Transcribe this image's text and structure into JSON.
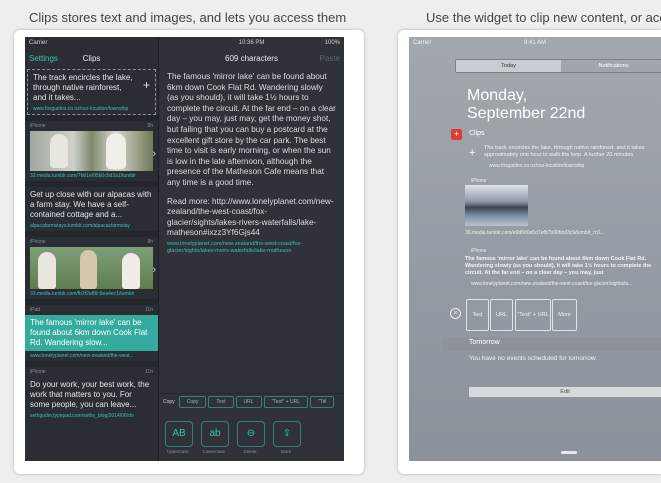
{
  "captions": {
    "left": "Clips stores text and images, and lets you access them easily later.",
    "right": "Use the widget to clip new content, or access your s"
  },
  "colors": {
    "accent": "#39c0b3",
    "dark": "#2a2e34",
    "selected_row": "#35ab9f"
  },
  "left_device": {
    "status": {
      "carrier": "Carrier",
      "time": "10:36 PM",
      "battery": "100%"
    },
    "nav": {
      "settings": "Settings",
      "title": "Clips",
      "detail_title": "609 characters",
      "paste": "Paste"
    },
    "clips": [
      {
        "text": "The track encircles the lake, through native rainforest, and it takes...",
        "url": "www.foxguides.co.nz/our-location/township",
        "add": "+"
      },
      {
        "source": "iPhone",
        "time": "5h",
        "url": "33.media.tumblr.com/7bb1e6f5b0c6d3a1/tumblr",
        "chevron": "›"
      },
      {
        "text": "Get up close with our alpacas with a farm stay. We have a self-contained cottage and a...",
        "url": "alpacafarmstays.tumblr.com/alpacasfarmstay"
      },
      {
        "source": "iPhone",
        "time": "8h",
        "url": "33.media.tumblr.com/fb2f2a88c8ea4ec1/tumblr",
        "chevron": "›"
      },
      {
        "source": "iPad",
        "time": "11h",
        "text": "The famous 'mirror lake' can be found about 6km down Cook Flat Rd. Wandering slow...",
        "url": "www.lonelyplanet.com/new-zealand/the-west..."
      },
      {
        "source": "iPhone",
        "time": "11h",
        "text": "Do your work, your best work, the work that matters to you. For some people, you can leave...",
        "url": "sethgodin.typepad.com/seths_blog/2014/06/do"
      }
    ],
    "detail": {
      "body1": "The famous 'mirror lake' can be found about 6km down Cook Flat Rd. Wandering slowly (as you should), it will take 1½ hours to complete the circuit. At the far end – on a clear day – you may, just may, get the money shot, but failing that you can buy a postcard at the excellent gift store by the car park. The best time to visit is early morning, or when the sun is low in the late afternoon, although the presence of the Matheson Cafe means that any time is a good time.",
      "body2": "Read more: http://www.lonelyplanet.com/new-zealand/the-west-coast/fox-glacier/sights/lakes-rivers-waterfalls/lake-matheson#ixzz3Yf6Gjs44",
      "source": "www.lonelyplanet.com/new-zealand/the-west-coast/fox-glacier/sights/lakes-rivers-waterfalls/lake-matheson"
    },
    "actions": {
      "copy_label": "Copy",
      "copy": "Copy",
      "text": "Text",
      "url": "URL",
      "text_url": "\"Text\" + URL",
      "more": "\"Titl"
    },
    "big_buttons": [
      {
        "glyph": "AB",
        "label": "Uppercase"
      },
      {
        "glyph": "ab",
        "label": "Lowercase"
      },
      {
        "glyph": "⊖",
        "label": "Delete"
      },
      {
        "glyph": "⇪",
        "label": "More"
      }
    ]
  },
  "right_device": {
    "status": {
      "carrier": "Carrier",
      "time": "9:41 AM"
    },
    "segments": {
      "today": "Today",
      "notifications": "Notifications"
    },
    "date_line1": "Monday,",
    "date_line2": "September 22nd",
    "clips_header": "Clips",
    "widget_items": [
      {
        "add": "+",
        "text": "The track encircles the lake, through native rainforest, and it takes approximately one hour to walk the loop. A further 20 minutes",
        "url": "www.foxguides.co.nz/our-location/township"
      },
      {
        "source": "iPhone",
        "url": "36.media.tumblr.com/e9d6d0a5d7efb7b90bbd3c9/tumblr_rc0..."
      },
      {
        "source": "iPhone",
        "text": "The famous 'mirror lake' can be found about 6km down Cook Flat Rd. Wandering slowly (as you should), it will take 1½ hours to complete the circuit. At the far end – on a clear day – you may, just",
        "url": "www.lonelyplanet.com/new-zealand/the-west-coast/fox-glacier/sights/la..."
      }
    ],
    "widget_actions": {
      "text": "Text",
      "url": "URL",
      "text_url": "\"Text\" + URL",
      "more": "More"
    },
    "tomorrow_header": "Tomorrow",
    "tomorrow_text": "You have no events scheduled for tomorrow.",
    "edit": "Edit"
  }
}
